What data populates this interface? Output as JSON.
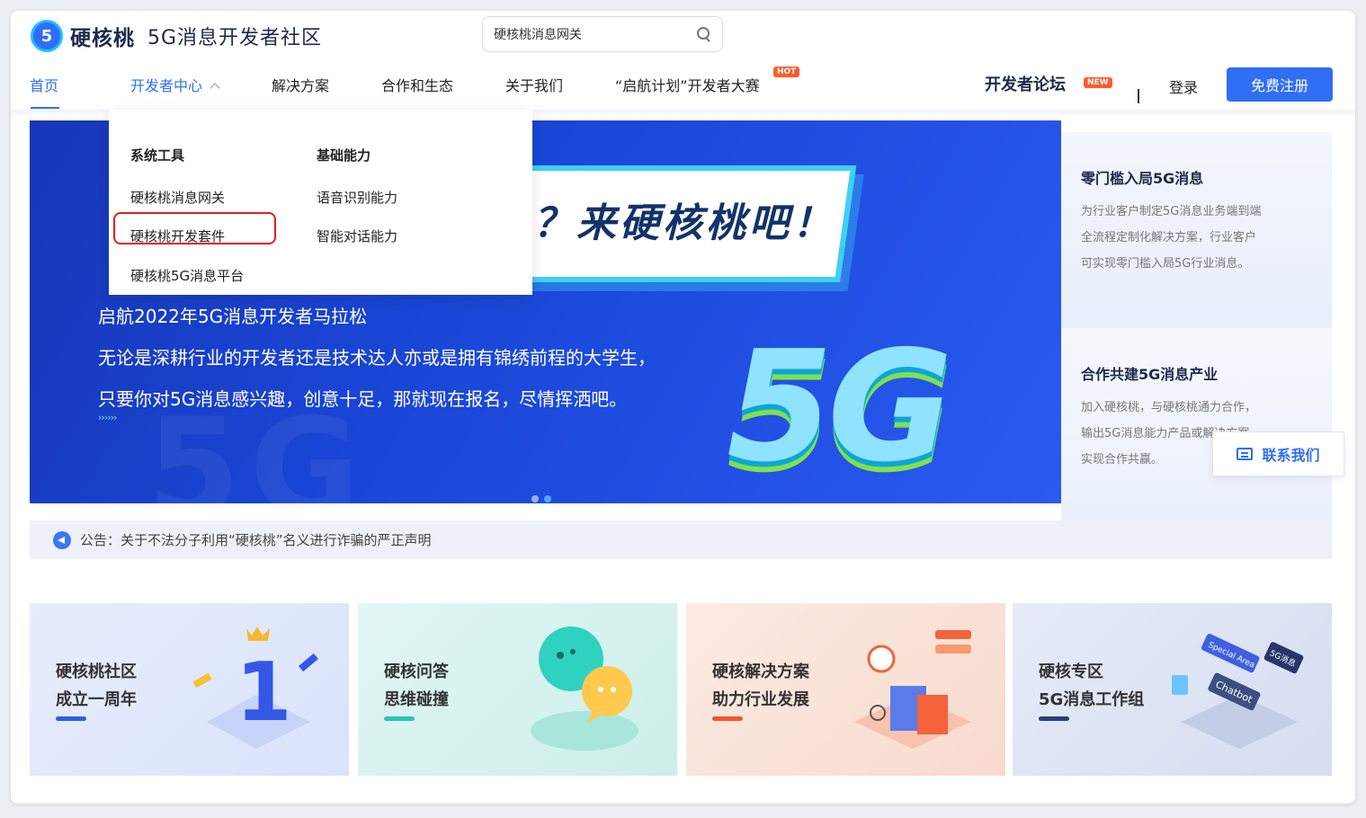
{
  "header": {
    "logo_mark": "5",
    "brand": "硬核桃",
    "subtitle": "5G消息开发者社区",
    "search_value": "硬核桃消息网关"
  },
  "nav": {
    "items": [
      {
        "label": "首页",
        "active": true
      },
      {
        "label": "开发者中心"
      },
      {
        "label": "解决方案"
      },
      {
        "label": "合作和生态"
      },
      {
        "label": "关于我们"
      },
      {
        "label": "“启航计划”开发者大赛",
        "badge": "HOT"
      }
    ],
    "forum_label": "开发者论坛",
    "forum_badge": "NEW",
    "divider": "|",
    "login": "登录",
    "signup": "免费注册"
  },
  "dropdown": {
    "col1_title": "系统工具",
    "col1_items": [
      "硬核桃消息网关",
      "硬核桃开发套件",
      "硬核桃5G消息平台"
    ],
    "col2_title": "基础能力",
    "col2_items": [
      "语音识别能力",
      "智能对话能力"
    ],
    "highlighted": "硬核桃开发套件"
  },
  "banner": {
    "slogan": "？来硬核桃吧！",
    "title": "启航2022年5G消息开发者马拉松",
    "line1": "无论是深耕行业的开发者还是技术达人亦或是拥有锦绣前程的大学生，",
    "line2": "只要你对5G消息感兴趣，创意十足，那就现在报名，尽情挥洒吧。",
    "arrows": "››››››",
    "big_text": "5G",
    "watermark": "5G",
    "slides": 2,
    "active_slide": 2
  },
  "side_cards": [
    {
      "title": "零门槛入局5G消息",
      "lines": [
        "为行业客户制定5G消息业务端到端",
        "全流程定制化解决方案，行业客户",
        "可实现零门槛入局5G行业消息。"
      ]
    },
    {
      "title": "合作共建5G消息产业",
      "lines": [
        "加入硬核桃，与硬核桃通力合作，",
        "输出5G消息能力产品或解决方案，",
        "实现合作共赢。"
      ]
    }
  ],
  "contact": "联系我们",
  "notice": "公告：关于不法分子利用“硬核桃”名义进行诈骗的严正声明",
  "tiles": [
    {
      "line1": "硬核桃社区",
      "line2": "成立一周年",
      "bar_color": "#2f5fe0"
    },
    {
      "line1": "硬核问答",
      "line2": "思维碰撞",
      "bar_color": "#2bc3b4"
    },
    {
      "line1": "硬核解决方案",
      "line2": "助力行业发展",
      "bar_color": "#f2552c"
    },
    {
      "line1": "硬核专区",
      "line2": "5G消息工作组",
      "bar_color": "#2b3f78"
    }
  ],
  "tile_art_labels": [
    "1",
    "Special Area",
    "Chatbot",
    "5G消息"
  ],
  "colors": {
    "accent": "#2f6ef5",
    "hot": "#ff5a2c",
    "highlight_border": "#e51b1b"
  }
}
